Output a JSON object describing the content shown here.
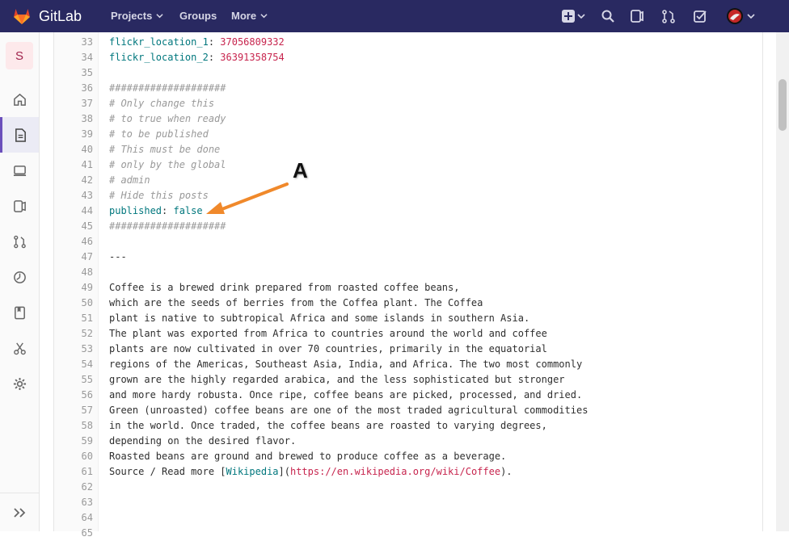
{
  "header": {
    "brand": "GitLab",
    "nav": [
      {
        "label": "Projects",
        "has_menu": true
      },
      {
        "label": "Groups",
        "has_menu": false
      },
      {
        "label": "More",
        "has_menu": true
      }
    ],
    "icons": [
      "plus-square-icon",
      "search-icon",
      "issues-icon",
      "merge-request-icon",
      "todo-check-icon",
      "user-avatar-icon"
    ],
    "bg_color": "#292961"
  },
  "sidebar": {
    "avatar_letter": "S",
    "items": [
      "home-icon",
      "repository-icon",
      "ci-icon",
      "issues-icon",
      "merge-requests-icon",
      "operations-icon",
      "wiki-icon",
      "snippets-icon",
      "settings-icon"
    ],
    "active_item": "repository-icon"
  },
  "code": {
    "lines": [
      {
        "n": "33",
        "parts": [
          {
            "t": "flickr_location_1",
            "c": "k"
          },
          {
            "t": ": ",
            "c": ""
          },
          {
            "t": "37056809332",
            "c": "n"
          }
        ]
      },
      {
        "n": "34",
        "parts": [
          {
            "t": "flickr_location_2",
            "c": "k"
          },
          {
            "t": ": ",
            "c": ""
          },
          {
            "t": "36391358754",
            "c": "n"
          }
        ]
      },
      {
        "n": "35",
        "parts": []
      },
      {
        "n": "36",
        "parts": [
          {
            "t": "####################",
            "c": "c"
          }
        ]
      },
      {
        "n": "37",
        "parts": [
          {
            "t": "# Only change this",
            "c": "c"
          }
        ]
      },
      {
        "n": "38",
        "parts": [
          {
            "t": "# to true when ready",
            "c": "c"
          }
        ]
      },
      {
        "n": "39",
        "parts": [
          {
            "t": "# to be published",
            "c": "c"
          }
        ]
      },
      {
        "n": "40",
        "parts": [
          {
            "t": "# This must be done",
            "c": "c"
          }
        ]
      },
      {
        "n": "41",
        "parts": [
          {
            "t": "# only by the global",
            "c": "c"
          }
        ]
      },
      {
        "n": "42",
        "parts": [
          {
            "t": "# admin",
            "c": "c"
          }
        ]
      },
      {
        "n": "43",
        "parts": [
          {
            "t": "# Hide this posts",
            "c": "c"
          }
        ]
      },
      {
        "n": "44",
        "parts": [
          {
            "t": "published",
            "c": "k"
          },
          {
            "t": ": ",
            "c": ""
          },
          {
            "t": "false",
            "c": "k"
          }
        ]
      },
      {
        "n": "45",
        "parts": [
          {
            "t": "####################",
            "c": "c"
          }
        ]
      },
      {
        "n": "46",
        "parts": []
      },
      {
        "n": "47",
        "parts": [
          {
            "t": "---",
            "c": ""
          }
        ]
      },
      {
        "n": "48",
        "parts": []
      },
      {
        "n": "49",
        "parts": [
          {
            "t": "Coffee is a brewed drink prepared from roasted coffee beans,",
            "c": ""
          }
        ]
      },
      {
        "n": "50",
        "parts": [
          {
            "t": "which are the seeds of berries from the Coffea plant. The Coffea",
            "c": ""
          }
        ]
      },
      {
        "n": "51",
        "parts": [
          {
            "t": "plant is native to subtropical Africa and some islands in southern Asia.",
            "c": ""
          }
        ]
      },
      {
        "n": "52",
        "parts": [
          {
            "t": "The plant was exported from Africa to countries around the world and coffee",
            "c": ""
          }
        ]
      },
      {
        "n": "53",
        "parts": [
          {
            "t": "plants are now cultivated in over 70 countries, primarily in the equatorial",
            "c": ""
          }
        ]
      },
      {
        "n": "54",
        "parts": [
          {
            "t": "regions of the Americas, Southeast Asia, India, and Africa. The two most commonly",
            "c": ""
          }
        ]
      },
      {
        "n": "55",
        "parts": [
          {
            "t": "grown are the highly regarded arabica, and the less sophisticated but stronger",
            "c": ""
          }
        ]
      },
      {
        "n": "56",
        "parts": [
          {
            "t": "and more hardy robusta. Once ripe, coffee beans are picked, processed, and dried.",
            "c": ""
          }
        ]
      },
      {
        "n": "57",
        "parts": [
          {
            "t": "Green (unroasted) coffee beans are one of the most traded agricultural commodities",
            "c": ""
          }
        ]
      },
      {
        "n": "58",
        "parts": [
          {
            "t": "in the world. Once traded, the coffee beans are roasted to varying degrees,",
            "c": ""
          }
        ]
      },
      {
        "n": "59",
        "parts": [
          {
            "t": "depending on the desired flavor.",
            "c": ""
          }
        ]
      },
      {
        "n": "60",
        "parts": [
          {
            "t": "Roasted beans are ground and brewed to produce coffee as a beverage.",
            "c": ""
          }
        ]
      },
      {
        "n": "61",
        "parts": [
          {
            "t": "Source / Read more [",
            "c": ""
          },
          {
            "t": "Wikipedia",
            "c": "link"
          },
          {
            "t": "](",
            "c": ""
          },
          {
            "t": "https://en.wikipedia.org/wiki/Coffee",
            "c": "url"
          },
          {
            "t": ").",
            "c": ""
          }
        ]
      },
      {
        "n": "62",
        "parts": []
      },
      {
        "n": "63",
        "parts": []
      },
      {
        "n": "64",
        "parts": []
      },
      {
        "n": "65",
        "parts": []
      }
    ]
  },
  "annotation": {
    "label": "A",
    "arrow_color": "#f0892b"
  }
}
